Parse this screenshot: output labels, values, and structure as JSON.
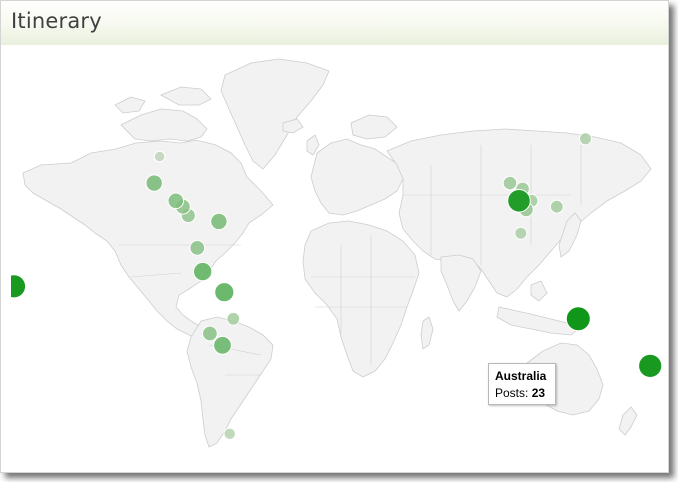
{
  "header": {
    "title": "Itinerary"
  },
  "tooltip": {
    "name": "Australia",
    "metric_label": "Posts:",
    "value": "23"
  },
  "colors": {
    "marker_low": "#c8d8c0",
    "marker_high": "#109618",
    "land": "#f2f2f2",
    "border": "#cdcdcd"
  },
  "markers": [
    {
      "id": "usa-south",
      "lon": -99,
      "lat": 30,
      "level": 0.05
    },
    {
      "id": "mexico",
      "lon": -102,
      "lat": 21,
      "level": 0.45
    },
    {
      "id": "central-america-1",
      "lon": -90,
      "lat": 15,
      "level": 0.4
    },
    {
      "id": "central-america-2",
      "lon": -86,
      "lat": 13,
      "level": 0.35
    },
    {
      "id": "central-america-3",
      "lon": -83,
      "lat": 10,
      "level": 0.3
    },
    {
      "id": "venezuela",
      "lon": -66,
      "lat": 8,
      "level": 0.45
    },
    {
      "id": "ecuador",
      "lon": -78,
      "lat": -1,
      "level": 0.35
    },
    {
      "id": "peru",
      "lon": -75,
      "lat": -9,
      "level": 0.6
    },
    {
      "id": "brazil-bolivia",
      "lon": -63,
      "lat": -16,
      "level": 0.65
    },
    {
      "id": "paraguay",
      "lon": -58,
      "lat": -25,
      "level": 0.2
    },
    {
      "id": "chile",
      "lon": -71,
      "lat": -30,
      "level": 0.35
    },
    {
      "id": "argentina",
      "lon": -64,
      "lat": -34,
      "level": 0.55
    },
    {
      "id": "antarctica",
      "lon": -60,
      "lat": -64,
      "level": 0.1
    },
    {
      "id": "japan",
      "lon": 138,
      "lat": 36,
      "level": 0.15
    },
    {
      "id": "myanmar",
      "lon": 96,
      "lat": 21,
      "level": 0.25
    },
    {
      "id": "thailand",
      "lon": 101,
      "lat": 15,
      "level": 0.9
    },
    {
      "id": "laos",
      "lon": 103,
      "lat": 19,
      "level": 0.25
    },
    {
      "id": "cambodia",
      "lon": 105,
      "lat": 12,
      "level": 0.3
    },
    {
      "id": "vietnam",
      "lon": 108,
      "lat": 15,
      "level": 0.2
    },
    {
      "id": "philippines",
      "lon": 122,
      "lat": 13,
      "level": 0.2
    },
    {
      "id": "malaysia",
      "lon": 102,
      "lat": 4,
      "level": 0.15
    },
    {
      "id": "australia",
      "lon": 134,
      "lat": -25,
      "level": 1.0
    },
    {
      "id": "new-zealand",
      "lon": 174,
      "lat": -41,
      "level": 0.95
    },
    {
      "id": "pacific-west",
      "lon": -180,
      "lat": -14,
      "level": 0.95
    }
  ]
}
